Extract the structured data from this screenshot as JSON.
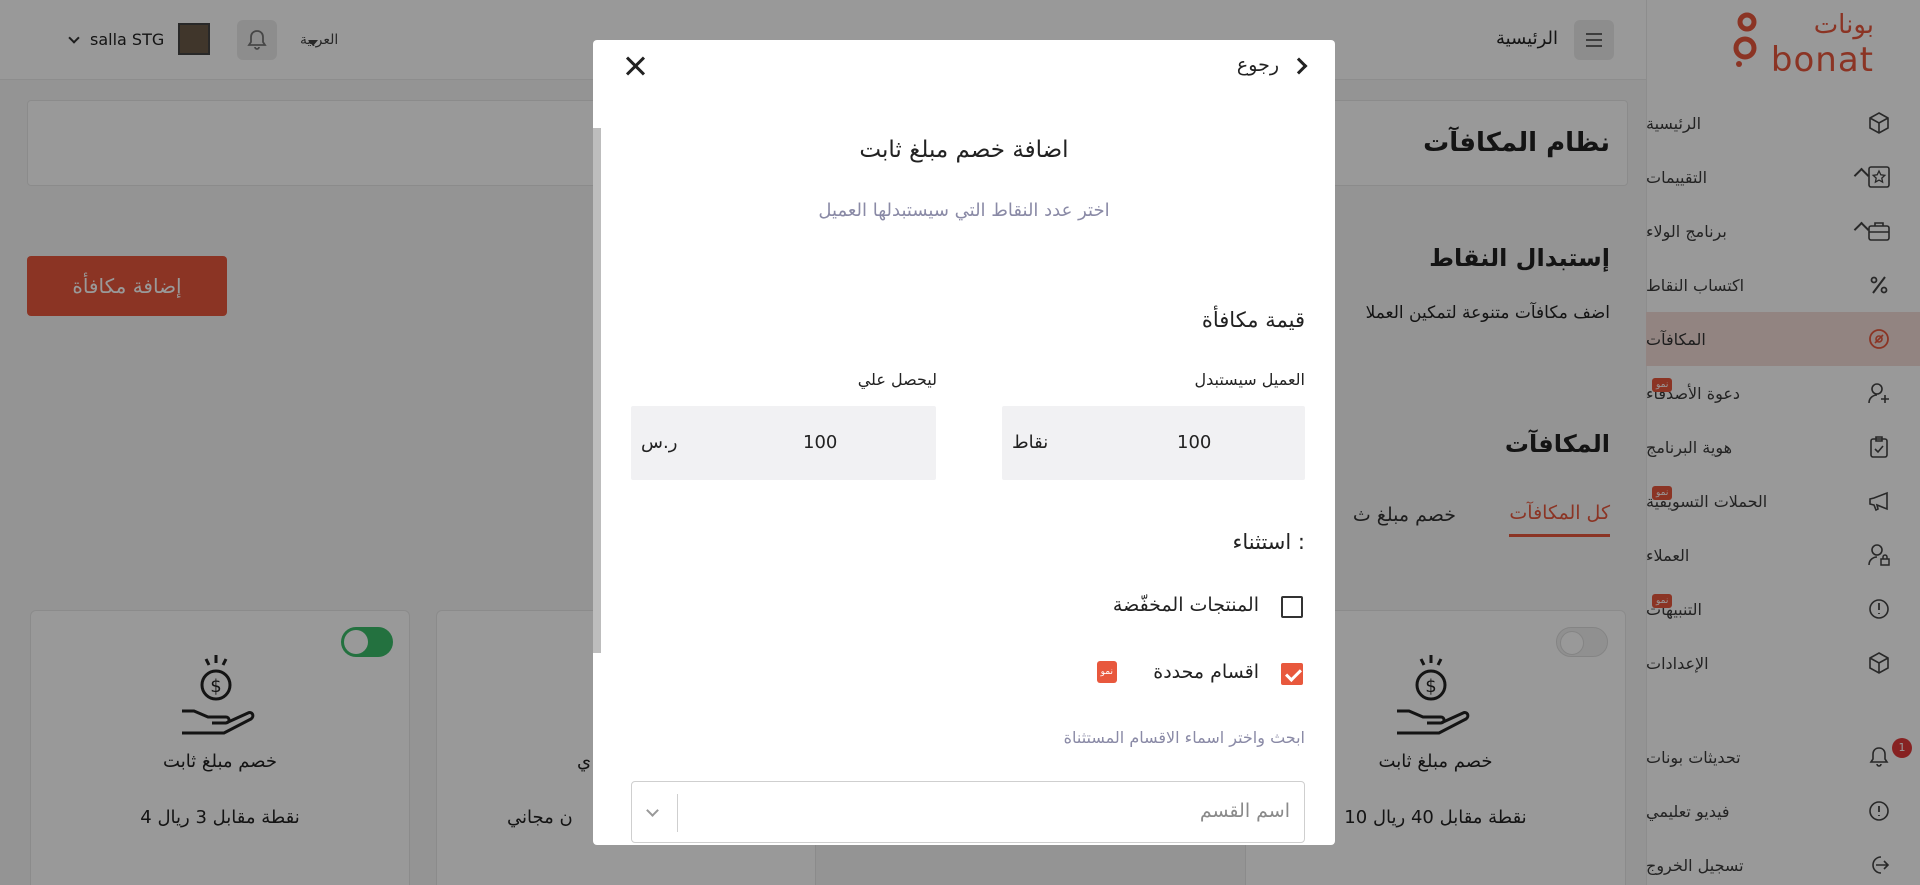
{
  "brand": {
    "arabic": "بونات",
    "latin": "bonat"
  },
  "sidebar": {
    "items": [
      {
        "label": "الرئيسية",
        "icon": "cube-icon"
      },
      {
        "label": "التقييمات",
        "icon": "star-icon"
      },
      {
        "label": "برنامج الولاء",
        "icon": "briefcase-icon"
      },
      {
        "label": "اكتساب النقاط",
        "icon": "percent-icon"
      },
      {
        "label": "المكافآت",
        "icon": "reward-icon"
      },
      {
        "label": "دعوة الأصدقاء",
        "icon": "add-user-icon",
        "badge": "نمو"
      },
      {
        "label": "هوية البرنامج",
        "icon": "clipboard-icon"
      },
      {
        "label": "الحملات التسويقية",
        "icon": "megaphone-icon",
        "badge": "نمو"
      },
      {
        "label": "العملاء",
        "icon": "user-lock-icon"
      },
      {
        "label": "التنبيهات",
        "icon": "alert-icon",
        "badge": "نمو"
      },
      {
        "label": "الإعدادات",
        "icon": "cube-icon"
      }
    ],
    "footer": [
      {
        "label": "تحديثات بونات",
        "icon": "bell-icon",
        "count": "1"
      },
      {
        "label": "فيديو تعليمي",
        "icon": "info-icon"
      },
      {
        "label": "تسجيل الخروج",
        "icon": "logout-icon"
      }
    ]
  },
  "topbar": {
    "home": "الرئيسية",
    "language": "العربية",
    "store": "salla STG"
  },
  "main": {
    "page_title": "نظام المكافآت",
    "add_button": "إضافة مكافأة",
    "section_title": "إستبدال النقاط",
    "section_desc": "اضف مكافآت متنوعة لتمكين العملا",
    "rewards_title": "المكافآت",
    "tabs": [
      "كل المكافآت",
      "خصم مبلغ ث"
    ],
    "cards": [
      {
        "title": "خصم مبلغ ثابت",
        "desc": "4 نقطة مقابل 3 ريال",
        "enabled": true
      },
      {
        "title": "ي",
        "desc": "ن مجاني"
      },
      {
        "title": "خصم مبلغ ثابت",
        "desc": "10 نقطة مقابل 40 ريال",
        "enabled": false
      }
    ]
  },
  "modal": {
    "back": "رجوع",
    "title": "اضافة خصم مبلغ ثابت",
    "subtitle": "اختر عدد النقاط التي سيستبدلها العميل",
    "reward_value_label": "قيمة مكافأة",
    "exchange_label": "العميل سيستبدل",
    "get_label": "ليحصل علي",
    "points_value": "100",
    "points_unit": "نقاط",
    "amount_value": "100",
    "amount_unit": "ر.س",
    "exception_label": "استثناء :",
    "options": [
      {
        "label": "المنتجات المخفّضة",
        "checked": false
      },
      {
        "label": "اقسام محددة",
        "checked": true,
        "badge": "نمو"
      }
    ],
    "search_help": "ابحث واختر اسماء الاقسام المستثناة",
    "category_placeholder": "اسم القسم"
  },
  "colors": {
    "accent": "#e8583d",
    "active_bg": "#f3ddd8",
    "toggle_on": "#3bbd6a"
  }
}
